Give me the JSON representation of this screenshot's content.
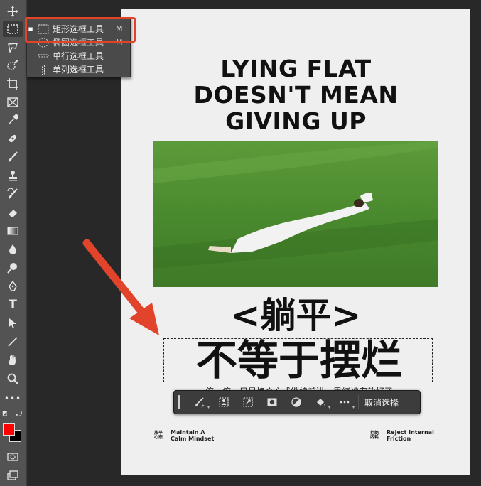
{
  "toolbar": {
    "tools": [
      {
        "name": "move-tool",
        "glyph": "✥"
      },
      {
        "name": "rectangular-marquee-tool",
        "glyph": "⬚",
        "active": true
      },
      {
        "name": "lasso-tool",
        "glyph": "ᘏ"
      },
      {
        "name": "quick-selection-tool",
        "glyph": "◌"
      },
      {
        "name": "crop-tool",
        "glyph": "⌗"
      },
      {
        "name": "frame-tool",
        "glyph": "⊠"
      },
      {
        "name": "eyedropper-tool",
        "glyph": "✎"
      },
      {
        "name": "healing-brush-tool",
        "glyph": "✚"
      },
      {
        "name": "brush-tool",
        "glyph": "🖌"
      },
      {
        "name": "clone-stamp-tool",
        "glyph": "⚲"
      },
      {
        "name": "history-brush-tool",
        "glyph": "↺"
      },
      {
        "name": "eraser-tool",
        "glyph": "⌫"
      },
      {
        "name": "gradient-tool",
        "glyph": "▤"
      },
      {
        "name": "blur-tool",
        "glyph": "💧"
      },
      {
        "name": "dodge-tool",
        "glyph": "🔍"
      },
      {
        "name": "pen-tool",
        "glyph": "✒"
      },
      {
        "name": "type-tool",
        "glyph": "T"
      },
      {
        "name": "path-selection-tool",
        "glyph": "➤"
      },
      {
        "name": "line-tool",
        "glyph": "╱"
      },
      {
        "name": "hand-tool",
        "glyph": "✋"
      },
      {
        "name": "zoom-tool",
        "glyph": "🔎"
      },
      {
        "name": "more-tools",
        "glyph": "•••"
      }
    ],
    "foreground_color": "#ff0000",
    "background_color": "#000000"
  },
  "flyout_menu": {
    "items": [
      {
        "label": "矩形选框工具",
        "shortcut": "M",
        "selected": true
      },
      {
        "label": "椭圆选框工具",
        "shortcut": "M",
        "selected": false
      },
      {
        "label": "单行选框工具",
        "shortcut": "",
        "selected": false
      },
      {
        "label": "单列选框工具",
        "shortcut": "",
        "selected": false
      }
    ],
    "highlight_color": "#e1432b"
  },
  "poster": {
    "headline": [
      "LYING FLAT",
      "DOESN'T MEAN",
      "GIVING UP"
    ],
    "zh_line1": "<躺平>",
    "zh_line2": "不等于摆烂",
    "zh_sub": "停一停，只是换个方式继续前进，思绪被安放好了",
    "footer_left": {
      "zh": "放平心态",
      "en": "Maintain A Calm Mindset"
    },
    "footer_right": {
      "zh": "拒绝内耗",
      "en": "Reject Internal Friction"
    }
  },
  "taskbar": {
    "buttons": [
      "generative-fill",
      "select-subject",
      "transform-selection",
      "mask-from-selection",
      "invert-selection",
      "fill-selection",
      "more-options"
    ],
    "deselect_label": "取消选择"
  },
  "annotation": {
    "arrow_color": "#e1432b"
  }
}
